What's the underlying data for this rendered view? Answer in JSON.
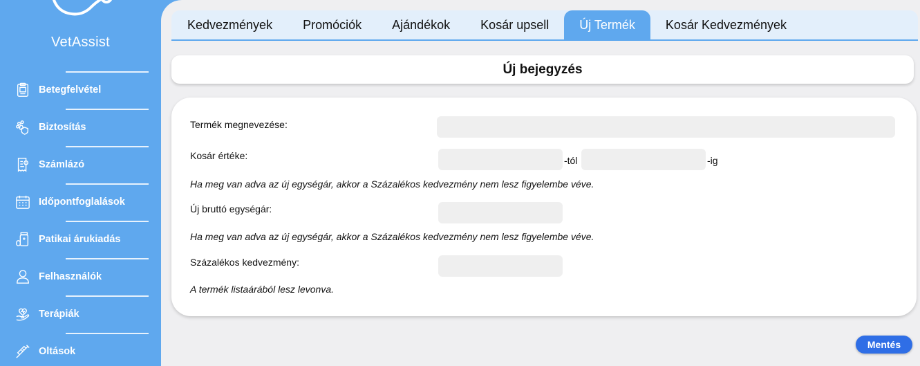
{
  "brand": {
    "name": "VetAssist"
  },
  "sidebar": {
    "items": [
      {
        "label": "Betegfelvétel",
        "icon": "clipboard-icon"
      },
      {
        "label": "Biztosítás",
        "icon": "paw-shield-icon"
      },
      {
        "label": "Számlázó",
        "icon": "invoice-icon"
      },
      {
        "label": "Időpontfoglalások",
        "icon": "calendar-icon"
      },
      {
        "label": "Patikai árukiadás",
        "icon": "medicine-icon"
      },
      {
        "label": "Felhasználók",
        "icon": "user-icon"
      },
      {
        "label": "Terápiák",
        "icon": "heart-hand-icon"
      },
      {
        "label": "Oltások",
        "icon": "syringe-icon"
      }
    ]
  },
  "tabs": [
    {
      "label": "Kedvezmények"
    },
    {
      "label": "Promóciók"
    },
    {
      "label": "Ajándékok"
    },
    {
      "label": "Kosár upsell"
    },
    {
      "label": "Új Termék",
      "active": true
    },
    {
      "label": "Kosár Kedvezmények"
    }
  ],
  "header": {
    "title": "Új bejegyzés"
  },
  "form": {
    "product_name_label": "Termék megnevezése:",
    "product_name_value": "",
    "cart_value_label": "Kosár értéke:",
    "cart_from_value": "",
    "cart_from_suffix": "-tól",
    "cart_to_value": "",
    "cart_to_suffix": "-ig",
    "note1": "Ha meg van adva az új egységár, akkor a Százalékos kedvezmény nem lesz figyelembe véve.",
    "unit_price_label": "Új bruttó egységár:",
    "unit_price_value": "",
    "note2": "Ha meg van adva az új egységár, akkor a Százalékos kedvezmény nem lesz figyelembe véve.",
    "percent_label": "Százalékos kedvezmény:",
    "percent_value": "",
    "note3": "A termék listaárából lesz levonva."
  },
  "actions": {
    "save_label": "Mentés"
  },
  "colors": {
    "primary": "#5fa8ee",
    "button": "#2f6ee6",
    "background": "#efeff1"
  }
}
